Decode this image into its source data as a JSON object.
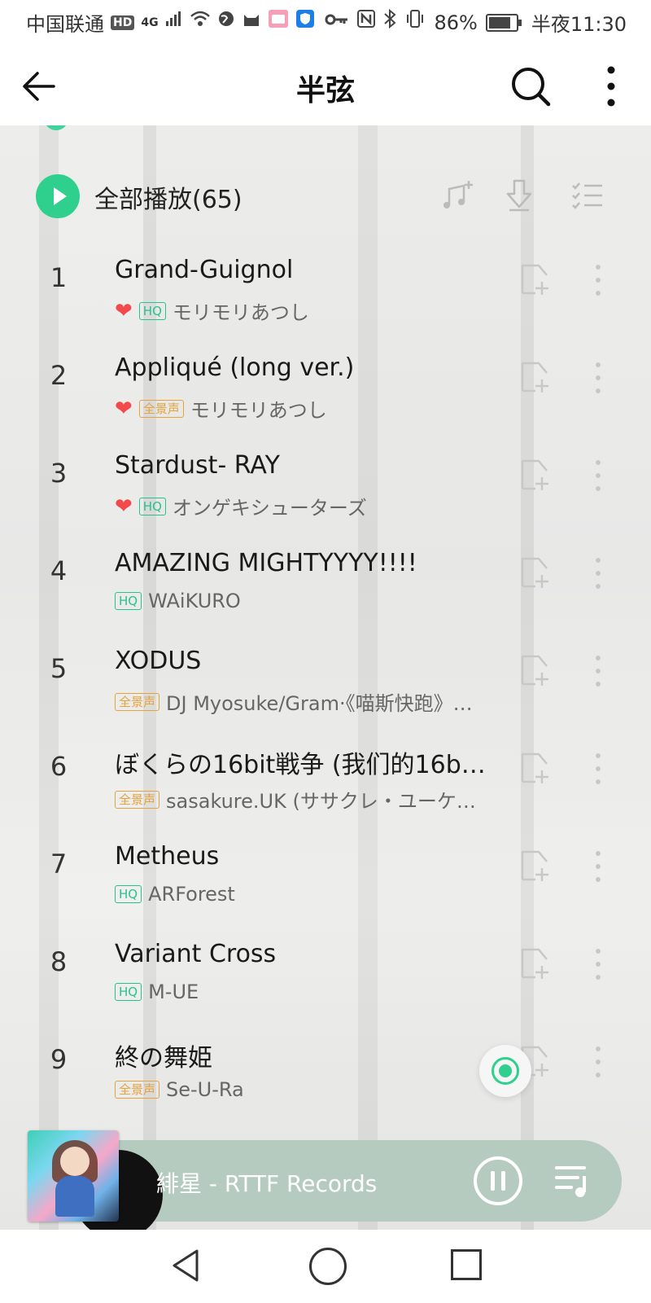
{
  "status_bar": {
    "carrier": "中国联通",
    "hd": "HD",
    "network": "4G",
    "battery": "86%",
    "time": "半夜11:30"
  },
  "header": {
    "title": "半弦"
  },
  "play_all": {
    "label": "全部播放(65)"
  },
  "songs": [
    {
      "num": "1",
      "title": "Grand-Guignol",
      "liked": true,
      "badge": "HQ",
      "badge_type": "hq",
      "artist": "モリモリあつし"
    },
    {
      "num": "2",
      "title": "Appliqué (long ver.)",
      "liked": true,
      "badge": "全景声",
      "badge_type": "full",
      "artist": "モリモリあつし"
    },
    {
      "num": "3",
      "title": "Stardust- RAY",
      "liked": true,
      "badge": "HQ",
      "badge_type": "hq",
      "artist": "オンゲキシューターズ"
    },
    {
      "num": "4",
      "title": "AMAZING MIGHTYYYY!!!!",
      "liked": false,
      "badge": "HQ",
      "badge_type": "hq",
      "artist": "WAiKURO"
    },
    {
      "num": "5",
      "title": "XODUS",
      "liked": false,
      "badge": "全景声",
      "badge_type": "full",
      "artist": "DJ Myosuke/Gram·《喵斯快跑》…"
    },
    {
      "num": "6",
      "title": "ぼくらの16bit戦争 (我们的16b…",
      "liked": false,
      "badge": "全景声",
      "badge_type": "full",
      "artist": "sasakure.UK (ササクレ・ユーケ…"
    },
    {
      "num": "7",
      "title": "Metheus",
      "liked": false,
      "badge": "HQ",
      "badge_type": "hq",
      "artist": "ARForest"
    },
    {
      "num": "8",
      "title": "Variant Cross",
      "liked": false,
      "badge": "HQ",
      "badge_type": "hq",
      "artist": "M-UE"
    },
    {
      "num": "9",
      "title": "終の舞姫",
      "liked": false,
      "badge": "全景声",
      "badge_type": "full",
      "artist": "Se-U-Ra"
    }
  ],
  "now_playing": {
    "text": "緋星 - RTTF Records"
  },
  "icons": {
    "back": "back-arrow-icon",
    "search": "search-icon",
    "more": "more-vertical-icon",
    "add_song": "add-music-icon",
    "download": "download-icon",
    "multi_select": "multi-select-list-icon",
    "add_to_playlist": "add-to-playlist-icon",
    "pause": "pause-icon",
    "queue": "playlist-queue-icon"
  },
  "colors": {
    "accent": "#2fd08e",
    "hq_badge": "#28c192",
    "full_badge": "#e6a23c",
    "heart": "#f24a4a",
    "mini_player": "#b5cbbf"
  }
}
